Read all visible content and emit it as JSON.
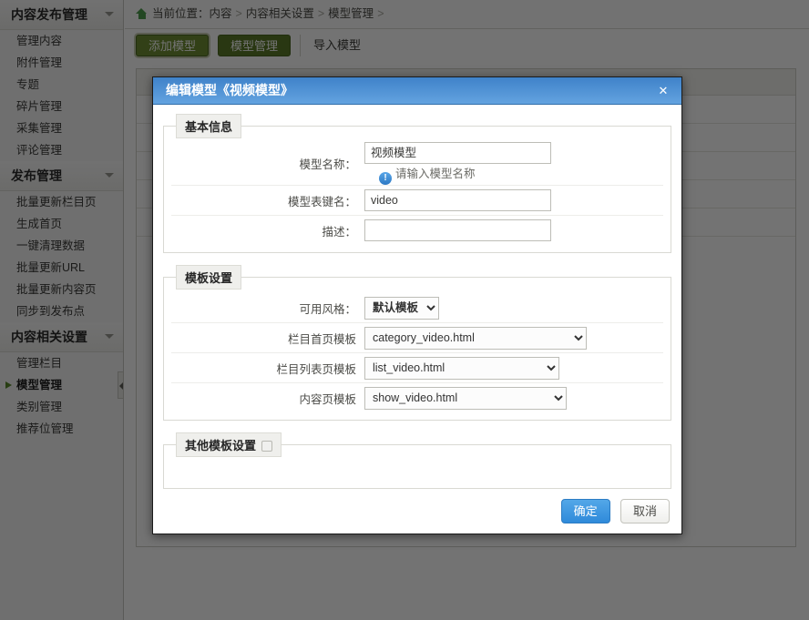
{
  "sidebar": {
    "groups": [
      {
        "title": "内容发布管理",
        "items": [
          "管理内容",
          "附件管理",
          "专题",
          "碎片管理",
          "采集管理",
          "评论管理"
        ]
      },
      {
        "title": "发布管理",
        "items": [
          "批量更新栏目页",
          "生成首页",
          "一键清理数据",
          "批量更新URL",
          "批量更新内容页",
          "同步到发布点"
        ]
      },
      {
        "title": "内容相关设置",
        "items": [
          "管理栏目",
          "模型管理",
          "类别管理",
          "推荐位管理"
        ],
        "active_item": "模型管理"
      }
    ],
    "collapse_handle": "collapse-sidebar-handle"
  },
  "breadcrumb": {
    "home_icon": "home-icon",
    "prefix": "当前位置：",
    "parts": [
      "内容",
      "内容相关设置",
      "模型管理"
    ],
    "separator": ">",
    "trailing": ">"
  },
  "toolbar": {
    "buttons": [
      {
        "label": "添加模型",
        "type": "button",
        "selected": true
      },
      {
        "label": "模型管理",
        "type": "button",
        "selected": false
      },
      {
        "label": "导入模型",
        "type": "link",
        "selected": false
      }
    ]
  },
  "dialog": {
    "title": "编辑模型《视频模型》",
    "close_icon": "close-icon",
    "sections": {
      "basic": {
        "legend": "基本信息",
        "rows": [
          {
            "label": "模型名称：",
            "value": "视频模型",
            "placeholder": "",
            "hint": "请输入模型名称",
            "hint_icon": "info-icon"
          },
          {
            "label": "模型表键名：",
            "value": "video",
            "placeholder": ""
          },
          {
            "label": "描述：",
            "value": "",
            "placeholder": ""
          }
        ]
      },
      "template": {
        "legend": "模板设置",
        "rows": [
          {
            "label": "可用风格：",
            "value": "默认模板"
          },
          {
            "label": "栏目首页模板",
            "value": "category_video.html"
          },
          {
            "label": "栏目列表页模板",
            "value": "list_video.html"
          },
          {
            "label": "内容页模板",
            "value": "show_video.html"
          }
        ]
      },
      "other": {
        "legend": "其他模板设置",
        "checkbox": "other-template-settings-checkbox",
        "checked": false
      }
    },
    "footer": {
      "confirm": "确定",
      "cancel": "取消"
    }
  },
  "colors": {
    "dialog_title_start": "#3f82c9",
    "dialog_title_end": "#63a3e0",
    "primary_button": "#2f8ada",
    "toolbar_button": "#5c7a28",
    "accent_green": "#5a8a2a",
    "overlay": "rgba(0,0,0,0.55)"
  }
}
